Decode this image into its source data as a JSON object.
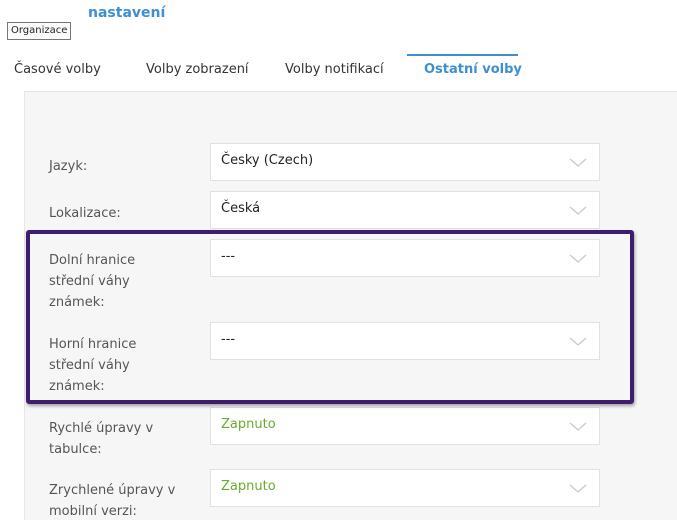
{
  "header": {
    "title": "nastavení",
    "tooltip": "Organizace"
  },
  "tabs": [
    {
      "label": "Časové volby",
      "active": false
    },
    {
      "label": "Volby zobrazení",
      "active": false
    },
    {
      "label": "Volby notifikací",
      "active": false
    },
    {
      "label": "Ostatní volby",
      "active": true
    }
  ],
  "settings": [
    {
      "label": "Jazyk:",
      "value": "Česky (Czech)"
    },
    {
      "label": "Lokalizace:",
      "value": "Česká"
    },
    {
      "label": "Dolní hranice střední váhy známek:",
      "value": "---"
    },
    {
      "label": "Horní hranice střední váhy známek:",
      "value": "---"
    },
    {
      "label": "Rychlé úpravy v tabulce:",
      "value": "Zapnuto"
    },
    {
      "label": "Zrychlené úpravy v mobilní verzi:",
      "value": "Zapnuto"
    }
  ],
  "colors": {
    "accent": "#3d8fd1",
    "enabled_value": "#6aab2a",
    "highlight_frame": "#3c1d6e"
  },
  "icons": {
    "dropdown": "chevron-down-icon"
  }
}
